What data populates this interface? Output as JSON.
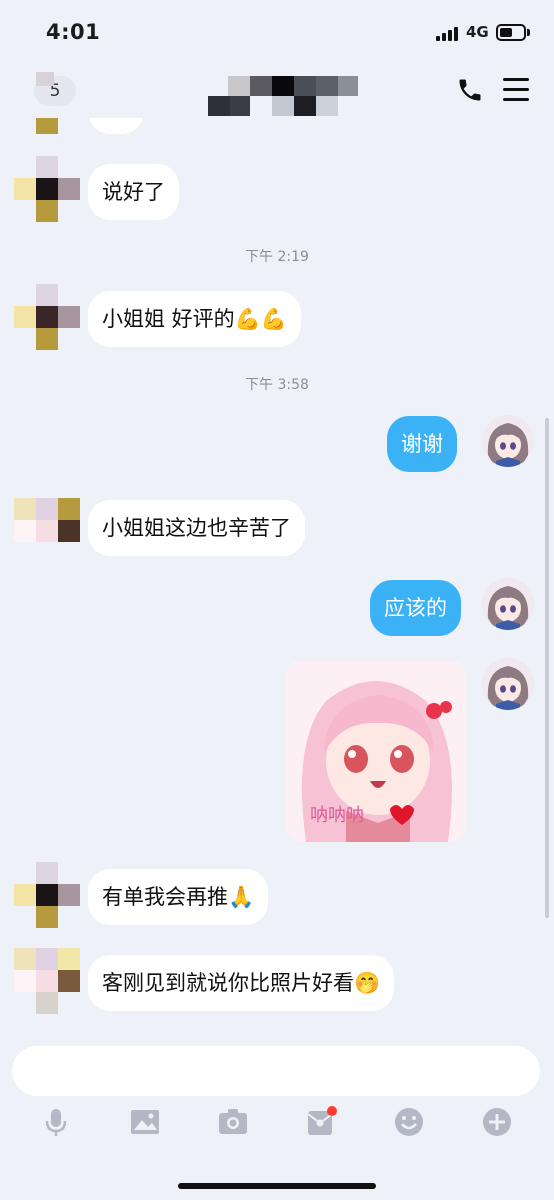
{
  "status_bar": {
    "time": "4:01",
    "network": "4G"
  },
  "nav": {
    "back_count": "5",
    "title": ""
  },
  "chat": {
    "messages": [
      {
        "sender": "other",
        "text": "说好了"
      },
      {
        "sender": "other",
        "text": "小姐姐 好评的💪💪"
      },
      {
        "sender": "me",
        "text": "谢谢"
      },
      {
        "sender": "other",
        "text": "小姐姐这边也辛苦了"
      },
      {
        "sender": "me",
        "text": "应该的"
      },
      {
        "sender": "me",
        "type": "sticker",
        "text": "呐呐呐"
      },
      {
        "sender": "other",
        "text": "有单我会再推🙏"
      },
      {
        "sender": "other",
        "text": "客刚见到就说你比照片好看🤭"
      }
    ],
    "timestamps": [
      "下午 2:19",
      "下午 3:58"
    ]
  },
  "toolbar": {
    "icons": [
      "microphone-icon",
      "image-icon",
      "camera-icon",
      "red-packet-icon",
      "emoji-icon",
      "plus-icon"
    ],
    "notification_color": "#ff3b30"
  },
  "colors": {
    "my_bubble": "#3ab2f5",
    "other_bubble": "#ffffff",
    "background": "#eef1f7"
  }
}
